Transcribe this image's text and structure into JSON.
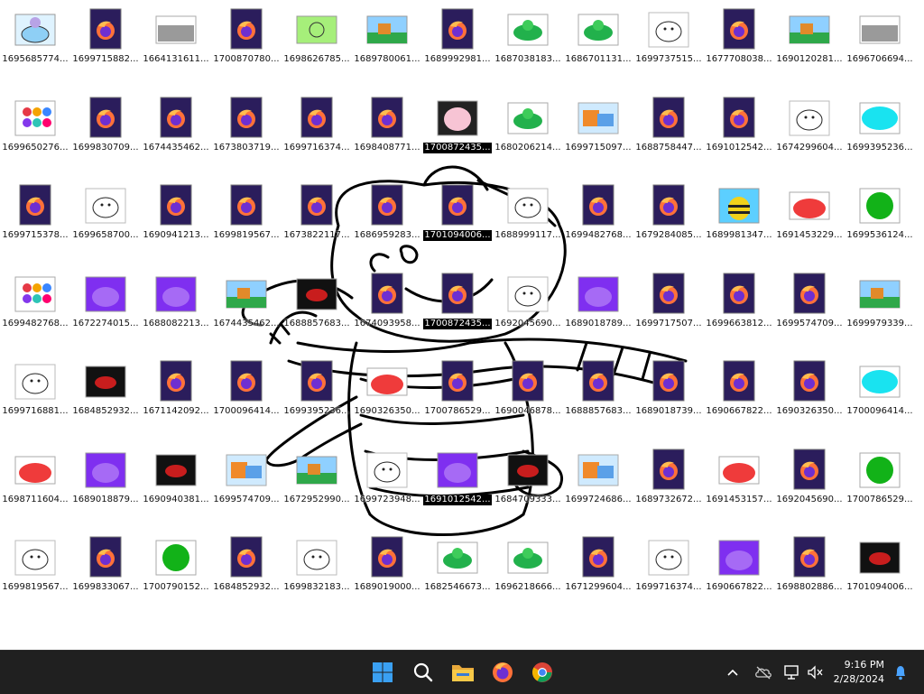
{
  "desktop": {
    "icons": [
      {
        "label": "1695685774...",
        "thumb": "bluecat"
      },
      {
        "label": "1699715882...",
        "thumb": "firefox"
      },
      {
        "label": "1664131611...",
        "thumb": "gray"
      },
      {
        "label": "1700870780...",
        "thumb": "firefox"
      },
      {
        "label": "1698626785...",
        "thumb": "lime"
      },
      {
        "label": "1689780061...",
        "thumb": "scene"
      },
      {
        "label": "1689992981...",
        "thumb": "firefox"
      },
      {
        "label": "1687038183...",
        "thumb": "green"
      },
      {
        "label": "1686701131...",
        "thumb": "green"
      },
      {
        "label": "1699737515...",
        "thumb": "sketch"
      },
      {
        "label": "1677708038...",
        "thumb": "firefox"
      },
      {
        "label": "1690120281...",
        "thumb": "scene"
      },
      {
        "label": "1696706694...",
        "thumb": "gray"
      },
      {
        "label": "1699650276...",
        "thumb": "dots"
      },
      {
        "label": "1699830709...",
        "thumb": "firefox"
      },
      {
        "label": "1674435462...",
        "thumb": "firefox"
      },
      {
        "label": "1673803719...",
        "thumb": "firefox"
      },
      {
        "label": "1699716374...",
        "thumb": "firefox"
      },
      {
        "label": "1698408771...",
        "thumb": "firefox"
      },
      {
        "label": "1700872435...",
        "thumb": "pink",
        "selected": true
      },
      {
        "label": "1680206214...",
        "thumb": "green"
      },
      {
        "label": "1699715097...",
        "thumb": "orange"
      },
      {
        "label": "1688758447...",
        "thumb": "firefox"
      },
      {
        "label": "1691012542...",
        "thumb": "firefox"
      },
      {
        "label": "1674299604...",
        "thumb": "sketch"
      },
      {
        "label": "1699395236...",
        "thumb": "cyan"
      },
      {
        "label": "1699715378...",
        "thumb": "firefox"
      },
      {
        "label": "1699658700...",
        "thumb": "sketch"
      },
      {
        "label": "1690941213...",
        "thumb": "firefox"
      },
      {
        "label": "1699819567...",
        "thumb": "firefox"
      },
      {
        "label": "1673822117...",
        "thumb": "firefox"
      },
      {
        "label": "1686959283...",
        "thumb": "firefox"
      },
      {
        "label": "1701094006...",
        "thumb": "firefox",
        "selected": true
      },
      {
        "label": "1688999117...",
        "thumb": "sketch"
      },
      {
        "label": "1699482768...",
        "thumb": "firefox"
      },
      {
        "label": "1679284085...",
        "thumb": "firefox"
      },
      {
        "label": "1689981347...",
        "thumb": "bee"
      },
      {
        "label": "1691453229...",
        "thumb": "red"
      },
      {
        "label": "1699536124...",
        "thumb": "greendot"
      },
      {
        "label": "1699482768...",
        "thumb": "dots"
      },
      {
        "label": "1672274015...",
        "thumb": "purple"
      },
      {
        "label": "1688082213...",
        "thumb": "purple"
      },
      {
        "label": "1674435462...",
        "thumb": "scene"
      },
      {
        "label": "1688857683...",
        "thumb": "black"
      },
      {
        "label": "1674093958...",
        "thumb": "firefox"
      },
      {
        "label": "1700872435...",
        "thumb": "firefox",
        "selected": true
      },
      {
        "label": "1692045690...",
        "thumb": "sketch"
      },
      {
        "label": "1689018789...",
        "thumb": "purple"
      },
      {
        "label": "1699717507...",
        "thumb": "firefox"
      },
      {
        "label": "1699663812...",
        "thumb": "firefox"
      },
      {
        "label": "1699574709...",
        "thumb": "firefox"
      },
      {
        "label": "1699979339...",
        "thumb": "scene"
      },
      {
        "label": "1699716881...",
        "thumb": "sketch"
      },
      {
        "label": "1684852932...",
        "thumb": "black"
      },
      {
        "label": "1671142092...",
        "thumb": "firefox"
      },
      {
        "label": "1700096414...",
        "thumb": "firefox"
      },
      {
        "label": "1699395236...",
        "thumb": "firefox"
      },
      {
        "label": "1690326350...",
        "thumb": "red"
      },
      {
        "label": "1700786529...",
        "thumb": "firefox"
      },
      {
        "label": "1690046878...",
        "thumb": "firefox"
      },
      {
        "label": "1688857683...",
        "thumb": "firefox"
      },
      {
        "label": "1689018739...",
        "thumb": "firefox"
      },
      {
        "label": "1690667822...",
        "thumb": "firefox"
      },
      {
        "label": "1690326350...",
        "thumb": "firefox"
      },
      {
        "label": "1700096414...",
        "thumb": "cyan"
      },
      {
        "label": "1698711604...",
        "thumb": "red"
      },
      {
        "label": "1689018879...",
        "thumb": "purple"
      },
      {
        "label": "1690940381...",
        "thumb": "black"
      },
      {
        "label": "1699574709...",
        "thumb": "orange"
      },
      {
        "label": "1672952990...",
        "thumb": "scene"
      },
      {
        "label": "1699723948...",
        "thumb": "sketch"
      },
      {
        "label": "1691012542...",
        "thumb": "purple",
        "selected": true
      },
      {
        "label": "1684709333...",
        "thumb": "black"
      },
      {
        "label": "1699724686...",
        "thumb": "orange"
      },
      {
        "label": "1689732672...",
        "thumb": "firefox"
      },
      {
        "label": "1691453157...",
        "thumb": "red"
      },
      {
        "label": "1692045690...",
        "thumb": "firefox"
      },
      {
        "label": "1700786529...",
        "thumb": "greendot"
      },
      {
        "label": "1699819567...",
        "thumb": "sketch"
      },
      {
        "label": "1699833067...",
        "thumb": "firefox"
      },
      {
        "label": "1700790152...",
        "thumb": "greendot"
      },
      {
        "label": "1684852932...",
        "thumb": "firefox"
      },
      {
        "label": "1699832183...",
        "thumb": "sketch"
      },
      {
        "label": "1689019000...",
        "thumb": "firefox"
      },
      {
        "label": "1682546673...",
        "thumb": "green"
      },
      {
        "label": "1696218666...",
        "thumb": "green"
      },
      {
        "label": "1671299604...",
        "thumb": "firefox"
      },
      {
        "label": "1699716374...",
        "thumb": "sketch"
      },
      {
        "label": "1690667822...",
        "thumb": "purple"
      },
      {
        "label": "1698802886...",
        "thumb": "firefox"
      },
      {
        "label": "1701094006...",
        "thumb": "black"
      }
    ]
  },
  "taskbar": {
    "apps": [
      {
        "name": "start-button",
        "icon": "windows-icon"
      },
      {
        "name": "search-button",
        "icon": "search-icon"
      },
      {
        "name": "file-explorer-button",
        "icon": "folder-icon"
      },
      {
        "name": "firefox-button",
        "icon": "firefox-icon"
      },
      {
        "name": "chrome-button",
        "icon": "chrome-icon"
      }
    ],
    "clock": {
      "time": "9:16 PM",
      "date": "2/28/2024"
    }
  },
  "colors": {
    "taskbar": "#202020",
    "selection": "#000000",
    "firefox_dark": "#2b1d5c"
  }
}
